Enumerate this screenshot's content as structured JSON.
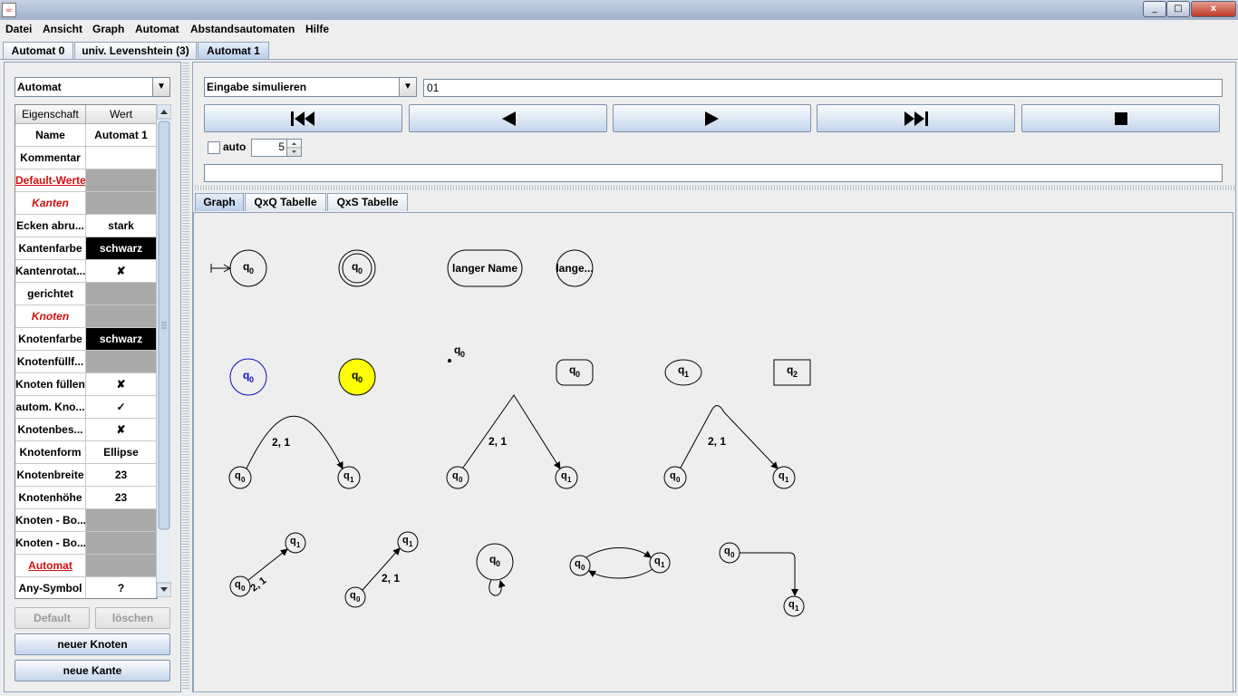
{
  "window": {
    "min": "_",
    "max": "□",
    "close": "x"
  },
  "menu": [
    "Datei",
    "Ansicht",
    "Graph",
    "Automat",
    "Abstandsautomaten",
    "Hilfe"
  ],
  "tabs": [
    "Automat 0",
    "univ. Levenshtein (3)",
    "Automat 1"
  ],
  "left": {
    "combo": "Automat",
    "headers": [
      "Eigenschaft",
      "Wert"
    ],
    "rows": [
      {
        "name": "Name",
        "value": "Automat 1"
      },
      {
        "name": "Kommentar",
        "value": ""
      },
      {
        "name": "Default-Werte",
        "value": ""
      },
      {
        "name": "Kanten",
        "value": ""
      },
      {
        "name": "Ecken abru...",
        "value": "stark"
      },
      {
        "name": "Kantenfarbe",
        "value": "schwarz"
      },
      {
        "name": "Kantenrotat...",
        "value": "✘"
      },
      {
        "name": "gerichtet",
        "value": ""
      },
      {
        "name": "Knoten",
        "value": ""
      },
      {
        "name": "Knotenfarbe",
        "value": "schwarz"
      },
      {
        "name": "Knotenfüllf...",
        "value": ""
      },
      {
        "name": "Knoten füllen",
        "value": "✘"
      },
      {
        "name": "autom. Kno...",
        "value": "✓"
      },
      {
        "name": "Knotenbes...",
        "value": "✘"
      },
      {
        "name": "Knotenform",
        "value": "Ellipse"
      },
      {
        "name": "Knotenbreite",
        "value": "23"
      },
      {
        "name": "Knotenhöhe",
        "value": "23"
      },
      {
        "name": "Knoten - Bo...",
        "value": ""
      },
      {
        "name": "Knoten - Bo...",
        "value": ""
      },
      {
        "name": "Automat",
        "value": ""
      },
      {
        "name": "Any-Symbol",
        "value": "?"
      }
    ],
    "buttons": {
      "default": "Default",
      "delete": "löschen",
      "new_node": "neuer Knoten",
      "new_edge": "neue Kante"
    }
  },
  "sim": {
    "combo": "Eingabe simulieren",
    "input": "01",
    "auto_label": "auto",
    "auto_value": "5",
    "output": ""
  },
  "subtabs": [
    "Graph",
    "QxQ Tabelle",
    "QxS Tabelle"
  ],
  "graph": {
    "q0": "q",
    "sub0": "0",
    "sub1": "1",
    "sub2": "2",
    "long_name": "langer Name",
    "long_trunc": "lange...",
    "edge_label": "2, 1"
  }
}
